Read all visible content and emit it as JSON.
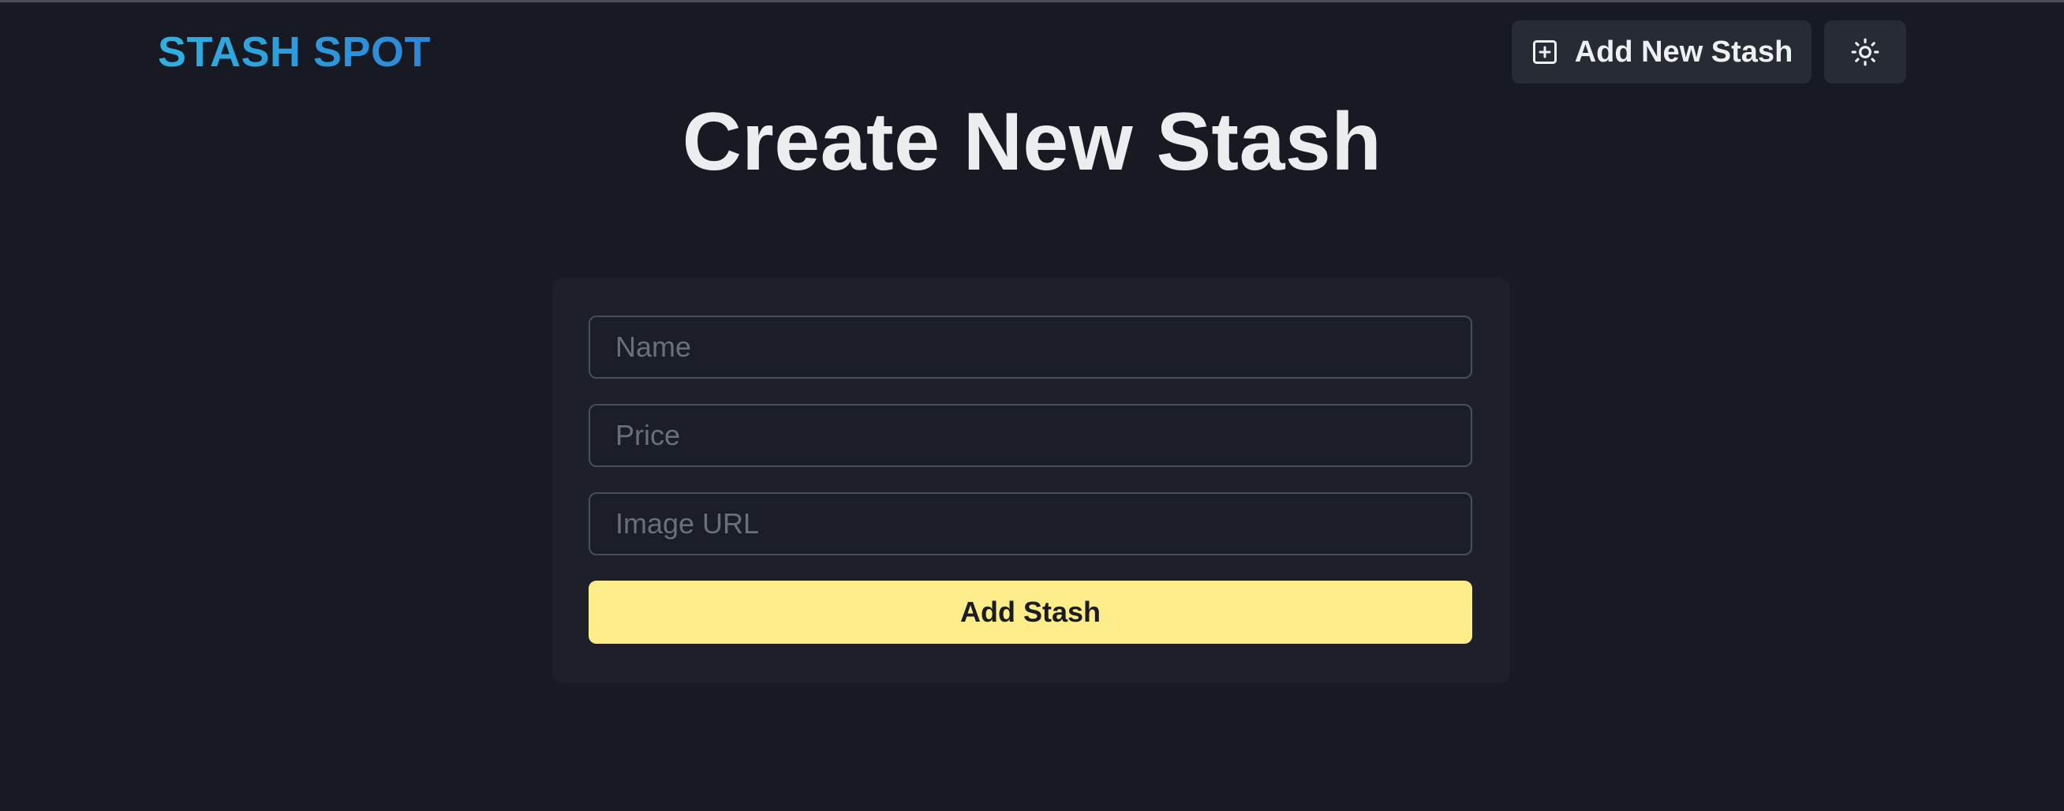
{
  "navbar": {
    "logo_text": "STASH SPOT",
    "add_new_label": "Add New Stash",
    "add_new_icon": "plus-square-icon",
    "theme_toggle_icon": "sun-icon"
  },
  "page": {
    "title": "Create New Stash"
  },
  "form": {
    "name_placeholder": "Name",
    "name_value": "",
    "price_placeholder": "Price",
    "price_value": "",
    "image_url_placeholder": "Image URL",
    "image_url_value": "",
    "submit_label": "Add Stash"
  },
  "colors": {
    "background": "#171923",
    "card": "#1d2029",
    "button": "#272b33",
    "accent_yellow": "#fcec8a",
    "logo_gradient_start": "#2fb1e0",
    "logo_gradient_end": "#2e86d6"
  }
}
